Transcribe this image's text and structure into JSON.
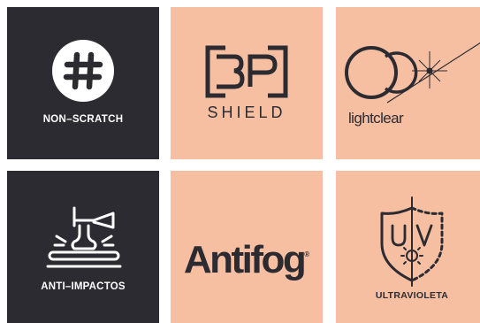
{
  "tiles": [
    {
      "label": "NON–SCRATCH",
      "icon": "hash-circle-icon",
      "theme": "dark"
    },
    {
      "label": "SHIELD",
      "icon": "bp-shield-logo-icon",
      "theme": "peach",
      "logo_letters": "BP"
    },
    {
      "label": "lightclear",
      "icon": "lens-flare-icon",
      "theme": "peach"
    },
    {
      "label": "ANTI–IMPACTOS",
      "icon": "hammer-impact-icon",
      "theme": "dark"
    },
    {
      "label": "Antifog",
      "mark": "®",
      "icon": "none",
      "theme": "peach"
    },
    {
      "label": "ULTRAVIOLETA",
      "icon": "uv-shield-icon",
      "theme": "peach",
      "icon_letters": "UV"
    }
  ],
  "colors": {
    "dark": "#2b2b31",
    "peach": "#f7bfa1",
    "white": "#ffffff"
  }
}
